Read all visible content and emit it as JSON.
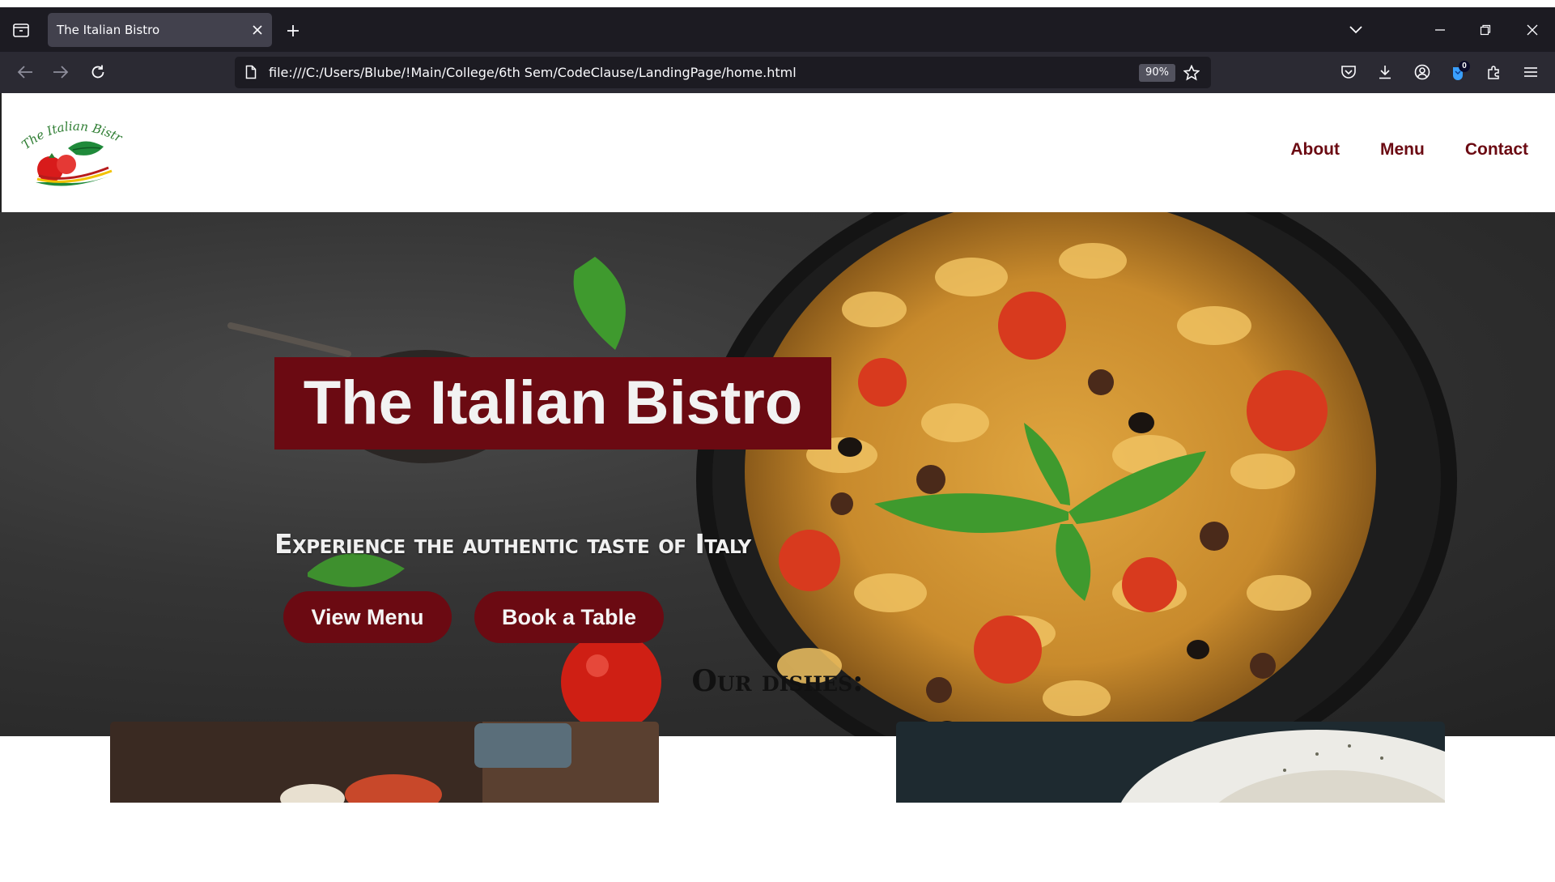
{
  "browser": {
    "tab": {
      "title": "The Italian Bistro"
    },
    "url": "file:///C:/Users/Blube/!Main/College/6th Sem/CodeClause/LandingPage/home.html",
    "zoom": "90%",
    "extension_badge": "0",
    "icons": [
      "tab-list-icon",
      "close-icon",
      "plus-icon",
      "chevron-down-icon",
      "minimize-icon",
      "restore-icon",
      "back-arrow-icon",
      "forward-arrow-icon",
      "reload-icon",
      "page-icon",
      "star-icon",
      "pocket-icon",
      "download-icon",
      "account-icon",
      "extension-icon",
      "puzzle-icon",
      "menu-icon"
    ]
  },
  "site": {
    "logo_text": "The Italian Bistro",
    "nav": {
      "about": "About",
      "menu": "Menu",
      "contact": "Contact"
    },
    "hero": {
      "title": "The Italian Bistro",
      "subtitle": "Experience the authentic taste of Italy",
      "view_menu": "View Menu",
      "book_table": "Book a Table"
    },
    "dishes_heading": "Our dishes:"
  },
  "colors": {
    "brand": "#6b0a12",
    "tab_bar": "#1c1b22",
    "toolbar": "#2b2a33",
    "active_tab": "#42414d"
  }
}
